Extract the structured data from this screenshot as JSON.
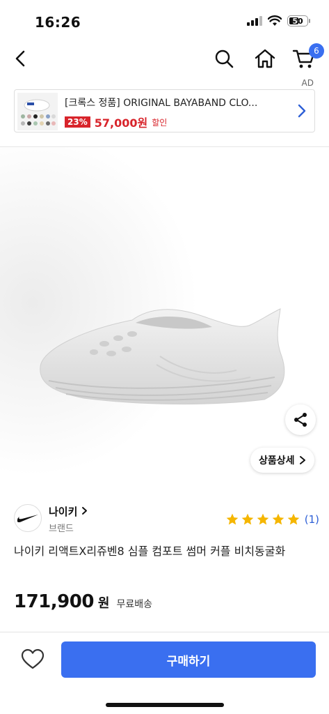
{
  "status_bar": {
    "time": "16:26",
    "battery": "50"
  },
  "nav": {
    "cart_count": "6"
  },
  "ad": {
    "label": "AD",
    "title": "[크록스 정품] ORIGINAL BAYABAND CLO...",
    "discount": "23%",
    "price": "57,000원",
    "sale_label": "할인"
  },
  "product": {
    "detail_button": "상품상세",
    "brand_name": "나이키",
    "brand_sub": "브랜드",
    "rating_stars": 5,
    "rating_count": "(1)",
    "title": "나이키 리액트X리쥬벤8 심플 컴포트 썸머 커플 비치동굴화",
    "price": "171,900",
    "price_unit": "원",
    "shipping": "무료배송"
  },
  "bottom_bar": {
    "buy_label": "구매하기"
  },
  "colors": {
    "accent": "#3a6ff0",
    "sale_red": "#d8242b",
    "star": "#f5b600"
  }
}
